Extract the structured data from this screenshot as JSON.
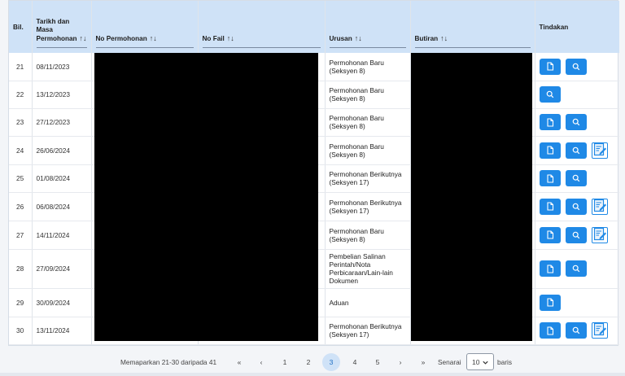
{
  "table": {
    "headers": {
      "bil": "Bil.",
      "tarikh": "Tarikh dan Masa Permohonan",
      "no_permohonan": "No Permohonan",
      "no_fail": "No Fail",
      "urusan": "Urusan",
      "butiran": "Butiran",
      "tindakan": "Tindakan"
    },
    "sort_glyph": "↑↓",
    "rows": [
      {
        "bil": "21",
        "date": "08/11/2023",
        "urusan": "Permohonan Baru (Seksyen 8)",
        "actions": [
          "doc",
          "view"
        ]
      },
      {
        "bil": "22",
        "date": "13/12/2023",
        "urusan": "Permohonan Baru (Seksyen 8)",
        "actions": [
          "view"
        ]
      },
      {
        "bil": "23",
        "date": "27/12/2023",
        "urusan": "Permohonan Baru (Seksyen 8)",
        "actions": [
          "doc",
          "view"
        ]
      },
      {
        "bil": "24",
        "date": "26/06/2024",
        "urusan": "Permohonan Baru (Seksyen 8)",
        "actions": [
          "doc",
          "view",
          "edit"
        ]
      },
      {
        "bil": "25",
        "date": "01/08/2024",
        "urusan": "Permohonan Berikutnya (Seksyen 17)",
        "actions": [
          "doc",
          "view"
        ]
      },
      {
        "bil": "26",
        "date": "06/08/2024",
        "urusan": "Permohonan Berikutnya (Seksyen 17)",
        "actions": [
          "doc",
          "view",
          "edit"
        ]
      },
      {
        "bil": "27",
        "date": "14/11/2024",
        "urusan": "Permohonan Baru (Seksyen 8)",
        "actions": [
          "doc",
          "view",
          "edit"
        ]
      },
      {
        "bil": "28",
        "date": "27/09/2024",
        "urusan": "Pembelian Salinan Perintah/Nota Perbicaraan/Lain-lain Dokumen",
        "actions": [
          "doc",
          "view"
        ],
        "tall": true
      },
      {
        "bil": "29",
        "date": "30/09/2024",
        "urusan": "Aduan",
        "actions": [
          "doc"
        ]
      },
      {
        "bil": "30",
        "date": "13/11/2024",
        "urusan": "Permohonan Berikutnya (Seksyen 17)",
        "actions": [
          "doc",
          "view",
          "edit"
        ]
      }
    ]
  },
  "pagination": {
    "info": "Memaparkan 21-30 daripada 41",
    "first": "«",
    "prev": "‹",
    "pages": [
      "1",
      "2",
      "3",
      "4",
      "5"
    ],
    "active_page": "3",
    "next": "›",
    "last": "»",
    "senarai_label": "Senarai",
    "page_size": "10",
    "baris_label": "baris"
  },
  "colors": {
    "header_bg": "#cfe2f7",
    "button_blue": "#1f89e6"
  },
  "icons": {
    "doc": "document-icon",
    "view": "search-icon",
    "edit": "edit-document-icon"
  }
}
